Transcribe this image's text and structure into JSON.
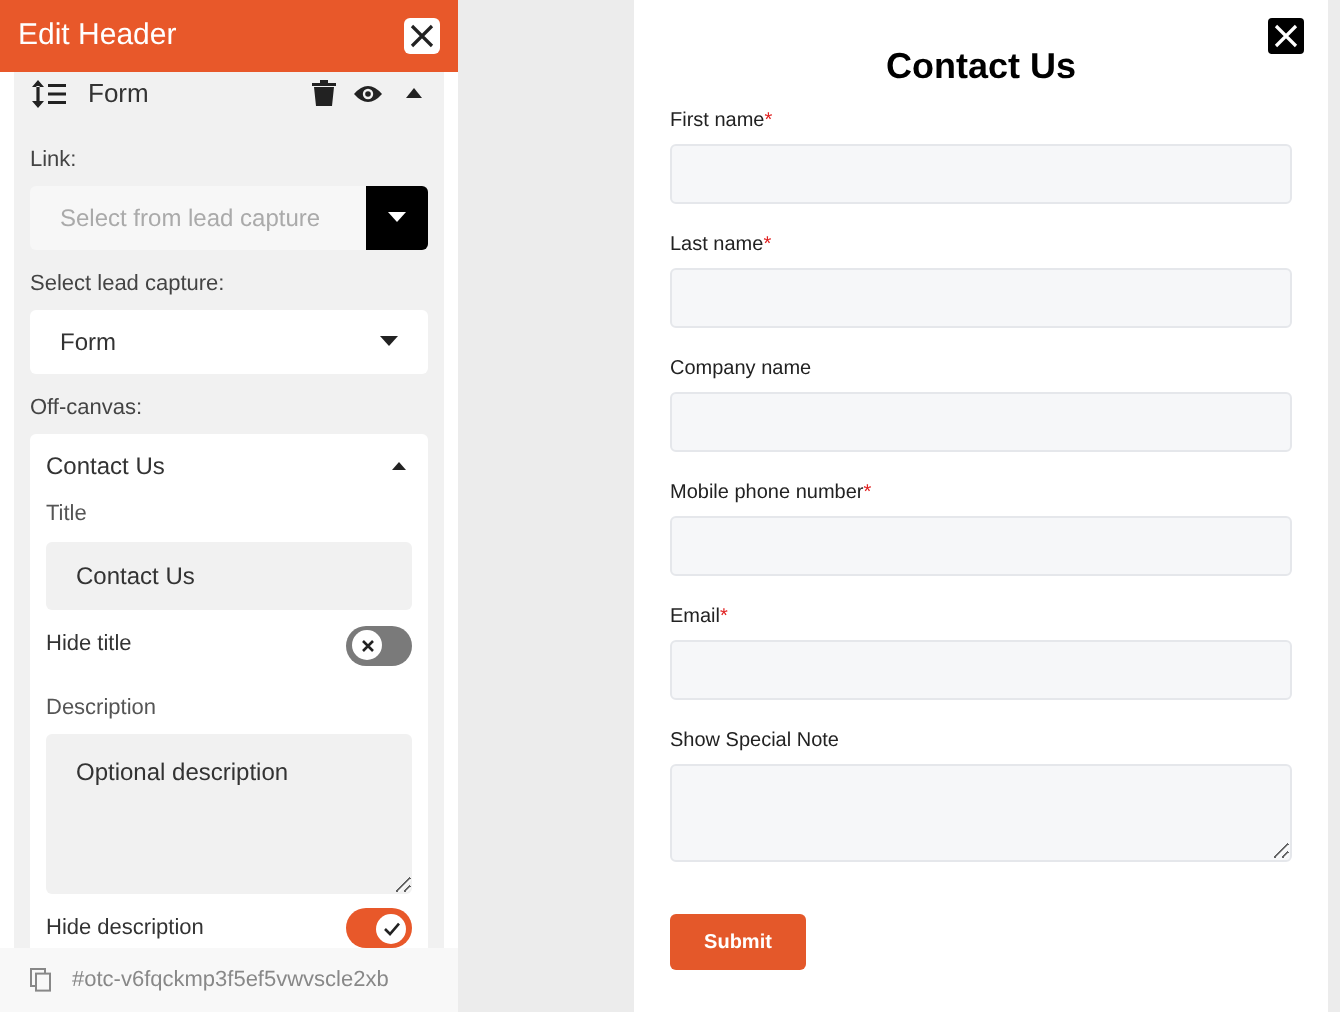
{
  "editor": {
    "title": "Edit Header",
    "block": {
      "label": "Form",
      "expanded": true
    },
    "link": {
      "label": "Link:",
      "placeholder": "Select from lead capture"
    },
    "lead_capture": {
      "label": "Select lead capture:",
      "value": "Form"
    },
    "off_canvas": {
      "label": "Off-canvas:",
      "name": "Contact Us",
      "expanded": true,
      "title_label": "Title",
      "title_value": "Contact Us",
      "toggles_1": {
        "label": "Hide title",
        "on": false
      },
      "description_label": "Description",
      "description_placeholder": "Optional description",
      "toggles_2": {
        "label": "Hide description",
        "on": true
      }
    },
    "element_id": "#otc-v6fqckmp3f5ef5vwvscle2xb"
  },
  "preview": {
    "title": "Contact Us",
    "fields": [
      {
        "label": "First name",
        "required_mark": "*",
        "kind": "input"
      },
      {
        "label": "Last name",
        "required_mark": "*",
        "kind": "input"
      },
      {
        "label": "Company name",
        "kind": "input"
      },
      {
        "label": "Mobile phone number",
        "required_mark": "*",
        "kind": "input"
      },
      {
        "label": "Email",
        "required_mark": "*",
        "kind": "input"
      },
      {
        "label": "Show Special Note",
        "kind": "textarea"
      }
    ],
    "submit": "Submit"
  }
}
